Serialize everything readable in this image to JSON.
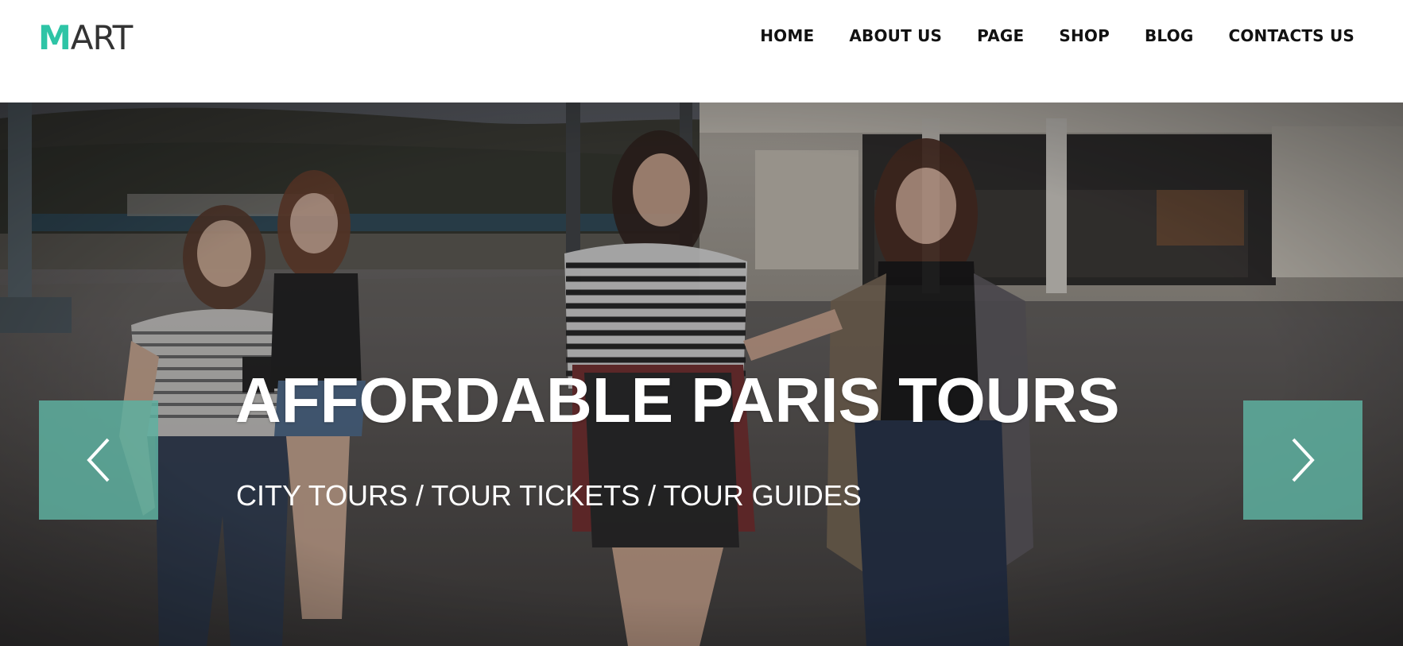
{
  "header": {
    "logo": {
      "accent": "M",
      "rest": "ART"
    },
    "nav": [
      "HOME",
      "ABOUT US",
      "PAGE",
      "SHOP",
      "BLOG",
      "CONTACTS US"
    ]
  },
  "hero": {
    "title": "AFFORDABLE PARIS TOURS",
    "subtitle": "CITY TOURS / TOUR TICKETS / TOUR GUIDES",
    "prev_icon": "chevron-left-icon",
    "next_icon": "chevron-right-icon"
  },
  "colors": {
    "accent": "#2ec4a6",
    "arrow_bg": "#5eb0a0",
    "nav_text": "#111111",
    "hero_text": "#ffffff"
  }
}
